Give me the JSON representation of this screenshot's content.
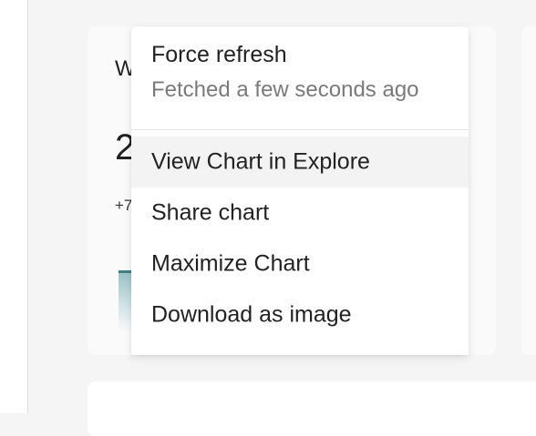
{
  "background_card": {
    "title_fragment": "W",
    "big_number_fragment": "2",
    "delta_fragment": "+7"
  },
  "menu": {
    "force_refresh": {
      "label": "Force refresh",
      "subtitle": "Fetched a few seconds ago"
    },
    "items": [
      {
        "label": "View Chart in Explore",
        "highlighted": true
      },
      {
        "label": "Share chart",
        "highlighted": false
      },
      {
        "label": "Maximize Chart",
        "highlighted": false
      },
      {
        "label": "Download as image",
        "highlighted": false
      }
    ]
  },
  "colors": {
    "menu_bg": "#ffffff",
    "highlight_bg": "#f3f3f3",
    "text_primary": "#222222",
    "text_secondary": "#7a7a7a",
    "sparkline": "#3f7f86"
  }
}
